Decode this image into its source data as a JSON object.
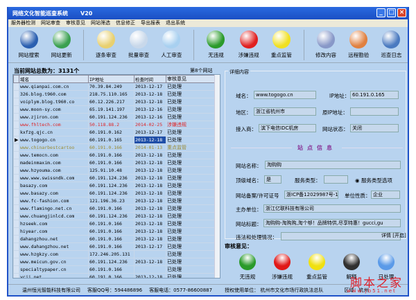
{
  "window": {
    "title": "网络文化智能巡查系统",
    "version": "V20"
  },
  "menu": [
    "服务器检测",
    "网站审查",
    "审核意见",
    "网站筛选",
    "信息修正",
    "导出报表",
    "退出系统"
  ],
  "toolbar": [
    {
      "label": "网站搜索",
      "icon": "globe-icon",
      "color": "#2a5fb0"
    },
    {
      "label": "网站更新",
      "icon": "refresh-icon",
      "color": "#3aa050"
    },
    {
      "label": "逐条审查",
      "icon": "magnifier-folder-icon",
      "color": "#e8d070"
    },
    {
      "label": "批量审查",
      "icon": "magnifier-icon",
      "color": "#c8d8ea"
    },
    {
      "label": "人工审查",
      "icon": "magnifier-icon",
      "color": "#a8d0f0"
    },
    {
      "label": "无违规",
      "icon": "green-magnifier-icon",
      "color": "#2a9a2a"
    },
    {
      "label": "涉嫌违规",
      "icon": "red-magnifier-icon",
      "color": "#e02020"
    },
    {
      "label": "重点监管",
      "icon": "yellow-magnifier-icon",
      "color": "#f0e020"
    },
    {
      "label": "修改内容",
      "icon": "calendar-icon",
      "color": "#8898c8"
    },
    {
      "label": "远程勘验",
      "icon": "remote-icon",
      "color": "#e08040"
    },
    {
      "label": "巡查日志",
      "icon": "monitor-log-icon",
      "color": "#4a7ac0"
    }
  ],
  "list": {
    "total_label": "当前网站总数为：3131个",
    "position_label": "第8个网站",
    "columns": [
      "域名",
      "IP地址",
      "检查时间",
      "审核意见"
    ],
    "rows": [
      [
        "www.qianpai.com.cn",
        "70.39.84.249",
        "2013-12-17",
        "已处理",
        ""
      ],
      [
        "326.blog.t960.com",
        "218.75.110.165",
        "2013-12-18",
        "已处理",
        ""
      ],
      [
        "voiplym.blog.t960.co",
        "60.12.226.217",
        "2013-12-18",
        "已处理",
        ""
      ],
      [
        "www.moon-sy.com",
        "65.19.141.197",
        "2013-12-16",
        "已处理",
        ""
      ],
      [
        "www.zjiron.com",
        "60.191.124.236",
        "2013-12-16",
        "已处理",
        ""
      ],
      [
        "www.fhltech.com",
        "50.118.88.2",
        "2014-02-25",
        "涉嫌违规",
        "red"
      ],
      [
        "kxfzg.qjc.cn",
        "60.191.0.162",
        "2013-12-17",
        "已处理",
        ""
      ],
      [
        "www.togogo.cn",
        "60.191.0.165",
        "2013-12-18",
        "已处理",
        "selected"
      ],
      [
        "www.chinarbestcartoo",
        "60.191.0.166",
        "2014-01-13",
        "重点监管",
        "olive"
      ],
      [
        "www.temocn.com",
        "60.191.0.166",
        "2013-12-18",
        "已处理",
        ""
      ],
      [
        "madeinmaxim.com",
        "60.191.0.166",
        "2013-12-18",
        "已处理",
        ""
      ],
      [
        "www.hzyouma.com",
        "125.91.10.48",
        "2013-12-18",
        "已处理",
        ""
      ],
      [
        "www.www.swissndk.com",
        "60.191.124.236",
        "2013-12-18",
        "已处理",
        ""
      ],
      [
        "basazy.com",
        "60.191.124.236",
        "2013-12-18",
        "已处理",
        ""
      ],
      [
        "www.basazy.com",
        "60.191.124.236",
        "2013-12-18",
        "已处理",
        ""
      ],
      [
        "www.fc-fashion.com",
        "121.196.36.23",
        "2013-12-18",
        "已处理",
        ""
      ],
      [
        "www.flamingo.net.cn",
        "60.191.0.166",
        "2013-12-18",
        "已处理",
        ""
      ],
      [
        "www.chuangjinlcd.com",
        "60.191.124.236",
        "2013-12-18",
        "已处理",
        ""
      ],
      [
        "hzseek.com",
        "60.191.0.166",
        "2013-12-18",
        "已处理",
        ""
      ],
      [
        "hiyear.com",
        "60.191.0.166",
        "2013-12-18",
        "已处理",
        ""
      ],
      [
        "dahangzhou.net",
        "60.191.0.166",
        "2013-12-18",
        "已处理",
        ""
      ],
      [
        "www.dahangzhou.net",
        "60.191.0.166",
        "2013-12-17",
        "已处理",
        ""
      ],
      [
        "www.hzgkzy.com",
        "172.246.205.131",
        "",
        "已处理",
        ""
      ],
      [
        "www.meicun.gov.cn",
        "60.191.124.236",
        "2013-12-18",
        "已处理",
        ""
      ],
      [
        "specialtypaper.cn",
        "60.191.0.166",
        "",
        "已处理",
        ""
      ],
      [
        "ycjj.net",
        "60.191.0.166",
        "2013-12-18",
        "已处理",
        ""
      ]
    ]
  },
  "detail": {
    "legend": "详细内容",
    "domain_label": "域名：",
    "domain": "www.togogo.cn",
    "ip_label": "IP地址：",
    "ip": "60.191.0.165",
    "region_label": "地区：",
    "region": "浙江省杭州市",
    "orig_ip_label": "原IP地址：",
    "orig_ip": "",
    "isp_label": "接入商：",
    "isp": "滨下电信IDC机房",
    "state_label": "网站状态：",
    "state": "关闭",
    "section": "站点信息",
    "name_label": "网站名称：",
    "name": "淘购购",
    "top_label": "顶级域名：",
    "top": "是",
    "svc_label": "服务类型：",
    "svc": "",
    "svc_opt": "服务类型选项",
    "icp_label": "网站备案/许可证号",
    "icp": "浙ICP备12029987号-1",
    "unit_label": "单位性质：",
    "unit": "企业",
    "host_label": "主办单位：",
    "host": "浙江亿联科技有限公司",
    "site_title_label": "网站标题：",
    "site_title": "淘购购-淘购购,淘个够！品牌特供,尽享特惠！gucci,gu",
    "viol_label": "违法和处理情况：",
    "viol": "",
    "more": "详情 [开启]"
  },
  "verdict": {
    "title": "审核意见：",
    "buttons": [
      {
        "label": "无违规",
        "color": "#2a9a2a"
      },
      {
        "label": "涉嫌违规",
        "color": "#e01818"
      },
      {
        "label": "重点监管",
        "color": "#f0e010"
      },
      {
        "label": "解释",
        "color": "#303030"
      },
      {
        "label": "已处理",
        "color": "#5a9ae8"
      }
    ]
  },
  "status": {
    "company": "温州恒光智能科技有限公司",
    "qq": "客服QQ号：594486896",
    "phone": "客服电话：0577-86600887",
    "licensee": "授权使用单位：  杭州市文化市场行政执法总队",
    "region": "区域：杭州"
  },
  "watermark": {
    "text": "脚本之家",
    "url": "www.jb51.net"
  }
}
